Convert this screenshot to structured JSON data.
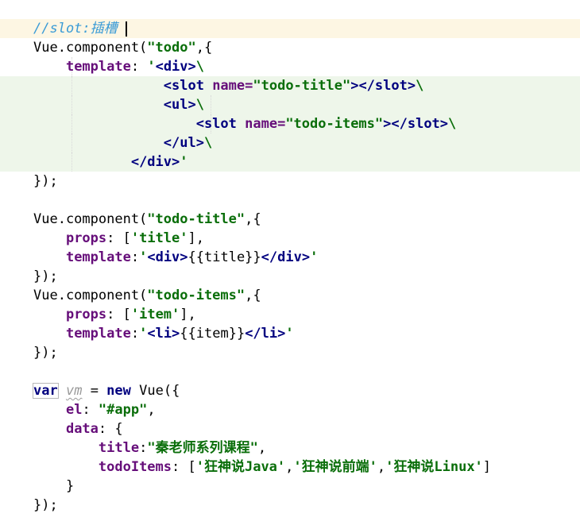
{
  "editor": {
    "colors": {
      "comment": "#3a9bd6",
      "string": "#0a6e0a",
      "tag": "#00007f",
      "key": "#660e7a",
      "keyword": "#00007f",
      "current_line_bg": "#fdf6e3",
      "changed_block_bg": "#eef6ea"
    },
    "lines": [
      {
        "tokens": [
          {
            "cls": "t-comment",
            "text": "//slot:插槽"
          }
        ]
      },
      {
        "tokens": [
          {
            "cls": "t-plain",
            "text": "Vue.component("
          },
          {
            "cls": "t-str",
            "text": "\"todo\""
          },
          {
            "cls": "t-plain",
            "text": ",{"
          }
        ]
      },
      {
        "tokens": [
          {
            "cls": "t-plain",
            "text": "    "
          },
          {
            "cls": "t-key",
            "text": "template"
          },
          {
            "cls": "t-plain",
            "text": ": "
          },
          {
            "cls": "t-str",
            "text": "'"
          },
          {
            "cls": "t-tag",
            "text": "<div>"
          },
          {
            "cls": "t-str",
            "text": "\\"
          }
        ]
      },
      {
        "tokens": [
          {
            "cls": "t-plain",
            "text": "                "
          },
          {
            "cls": "t-tag",
            "text": "<slot "
          },
          {
            "cls": "t-key",
            "text": "name="
          },
          {
            "cls": "t-attr",
            "text": "\"todo-title\""
          },
          {
            "cls": "t-tag",
            "text": "></slot>"
          },
          {
            "cls": "t-str",
            "text": "\\"
          }
        ]
      },
      {
        "tokens": [
          {
            "cls": "t-plain",
            "text": "                "
          },
          {
            "cls": "t-tag",
            "text": "<ul>"
          },
          {
            "cls": "t-str",
            "text": "\\"
          }
        ]
      },
      {
        "tokens": [
          {
            "cls": "t-plain",
            "text": "                    "
          },
          {
            "cls": "t-tag",
            "text": "<slot "
          },
          {
            "cls": "t-key",
            "text": "name="
          },
          {
            "cls": "t-attr",
            "text": "\"todo-items\""
          },
          {
            "cls": "t-tag",
            "text": "></slot>"
          },
          {
            "cls": "t-str",
            "text": "\\"
          }
        ]
      },
      {
        "tokens": [
          {
            "cls": "t-plain",
            "text": "                "
          },
          {
            "cls": "t-tag",
            "text": "</ul>"
          },
          {
            "cls": "t-str",
            "text": "\\"
          }
        ]
      },
      {
        "tokens": [
          {
            "cls": "t-plain",
            "text": "            "
          },
          {
            "cls": "t-tag",
            "text": "</div>"
          },
          {
            "cls": "t-str",
            "text": "'"
          }
        ]
      },
      {
        "tokens": [
          {
            "cls": "t-plain",
            "text": "});"
          }
        ]
      },
      {
        "tokens": []
      },
      {
        "tokens": [
          {
            "cls": "t-plain",
            "text": "Vue.component("
          },
          {
            "cls": "t-str",
            "text": "\"todo-title\""
          },
          {
            "cls": "t-plain",
            "text": ",{"
          }
        ]
      },
      {
        "tokens": [
          {
            "cls": "t-plain",
            "text": "    "
          },
          {
            "cls": "t-key",
            "text": "props"
          },
          {
            "cls": "t-plain",
            "text": ": ["
          },
          {
            "cls": "t-str",
            "text": "'title'"
          },
          {
            "cls": "t-plain",
            "text": "],"
          }
        ]
      },
      {
        "tokens": [
          {
            "cls": "t-plain",
            "text": "    "
          },
          {
            "cls": "t-key",
            "text": "template"
          },
          {
            "cls": "t-plain",
            "text": ":"
          },
          {
            "cls": "t-str",
            "text": "'"
          },
          {
            "cls": "t-tag",
            "text": "<div>"
          },
          {
            "cls": "t-plain",
            "text": "{{title}}"
          },
          {
            "cls": "t-tag",
            "text": "</div>"
          },
          {
            "cls": "t-str",
            "text": "'"
          }
        ]
      },
      {
        "tokens": [
          {
            "cls": "t-plain",
            "text": "});"
          }
        ]
      },
      {
        "tokens": [
          {
            "cls": "t-plain",
            "text": "Vue.component("
          },
          {
            "cls": "t-str",
            "text": "\"todo-items\""
          },
          {
            "cls": "t-plain",
            "text": ",{"
          }
        ]
      },
      {
        "tokens": [
          {
            "cls": "t-plain",
            "text": "    "
          },
          {
            "cls": "t-key",
            "text": "props"
          },
          {
            "cls": "t-plain",
            "text": ": ["
          },
          {
            "cls": "t-str",
            "text": "'item'"
          },
          {
            "cls": "t-plain",
            "text": "],"
          }
        ]
      },
      {
        "tokens": [
          {
            "cls": "t-plain",
            "text": "    "
          },
          {
            "cls": "t-key",
            "text": "template"
          },
          {
            "cls": "t-plain",
            "text": ":"
          },
          {
            "cls": "t-str",
            "text": "'"
          },
          {
            "cls": "t-tag",
            "text": "<li>"
          },
          {
            "cls": "t-plain",
            "text": "{{item}}"
          },
          {
            "cls": "t-tag",
            "text": "</li>"
          },
          {
            "cls": "t-str",
            "text": "'"
          }
        ]
      },
      {
        "tokens": [
          {
            "cls": "t-plain",
            "text": "});"
          }
        ]
      },
      {
        "tokens": []
      },
      {
        "tokens": [
          {
            "cls": "t-kw var-box",
            "text": "var"
          },
          {
            "cls": "t-plain",
            "text": " "
          },
          {
            "cls": "t-var squiggle",
            "text": "vm"
          },
          {
            "cls": "t-plain",
            "text": " = "
          },
          {
            "cls": "t-kw",
            "text": "new"
          },
          {
            "cls": "t-plain",
            "text": " Vue({"
          }
        ]
      },
      {
        "tokens": [
          {
            "cls": "t-plain",
            "text": "    "
          },
          {
            "cls": "t-key",
            "text": "el"
          },
          {
            "cls": "t-plain",
            "text": ": "
          },
          {
            "cls": "t-str",
            "text": "\"#app\""
          },
          {
            "cls": "t-plain",
            "text": ","
          }
        ]
      },
      {
        "tokens": [
          {
            "cls": "t-plain",
            "text": "    "
          },
          {
            "cls": "t-key",
            "text": "data"
          },
          {
            "cls": "t-plain",
            "text": ": {"
          }
        ]
      },
      {
        "tokens": [
          {
            "cls": "t-plain",
            "text": "        "
          },
          {
            "cls": "t-key",
            "text": "title"
          },
          {
            "cls": "t-plain",
            "text": ":"
          },
          {
            "cls": "t-str",
            "text": "\"秦老师系列课程\""
          },
          {
            "cls": "t-plain",
            "text": ","
          }
        ]
      },
      {
        "tokens": [
          {
            "cls": "t-plain",
            "text": "        "
          },
          {
            "cls": "t-key",
            "text": "todoItems"
          },
          {
            "cls": "t-plain",
            "text": ": ["
          },
          {
            "cls": "t-str",
            "text": "'狂神说Java'"
          },
          {
            "cls": "t-plain",
            "text": ","
          },
          {
            "cls": "t-str",
            "text": "'狂神说前端'"
          },
          {
            "cls": "t-plain",
            "text": ","
          },
          {
            "cls": "t-str",
            "text": "'狂神说Linux'"
          },
          {
            "cls": "t-plain",
            "text": "]"
          }
        ]
      },
      {
        "tokens": [
          {
            "cls": "t-plain",
            "text": "    }"
          }
        ]
      },
      {
        "tokens": [
          {
            "cls": "t-plain",
            "text": "});"
          }
        ]
      }
    ]
  }
}
